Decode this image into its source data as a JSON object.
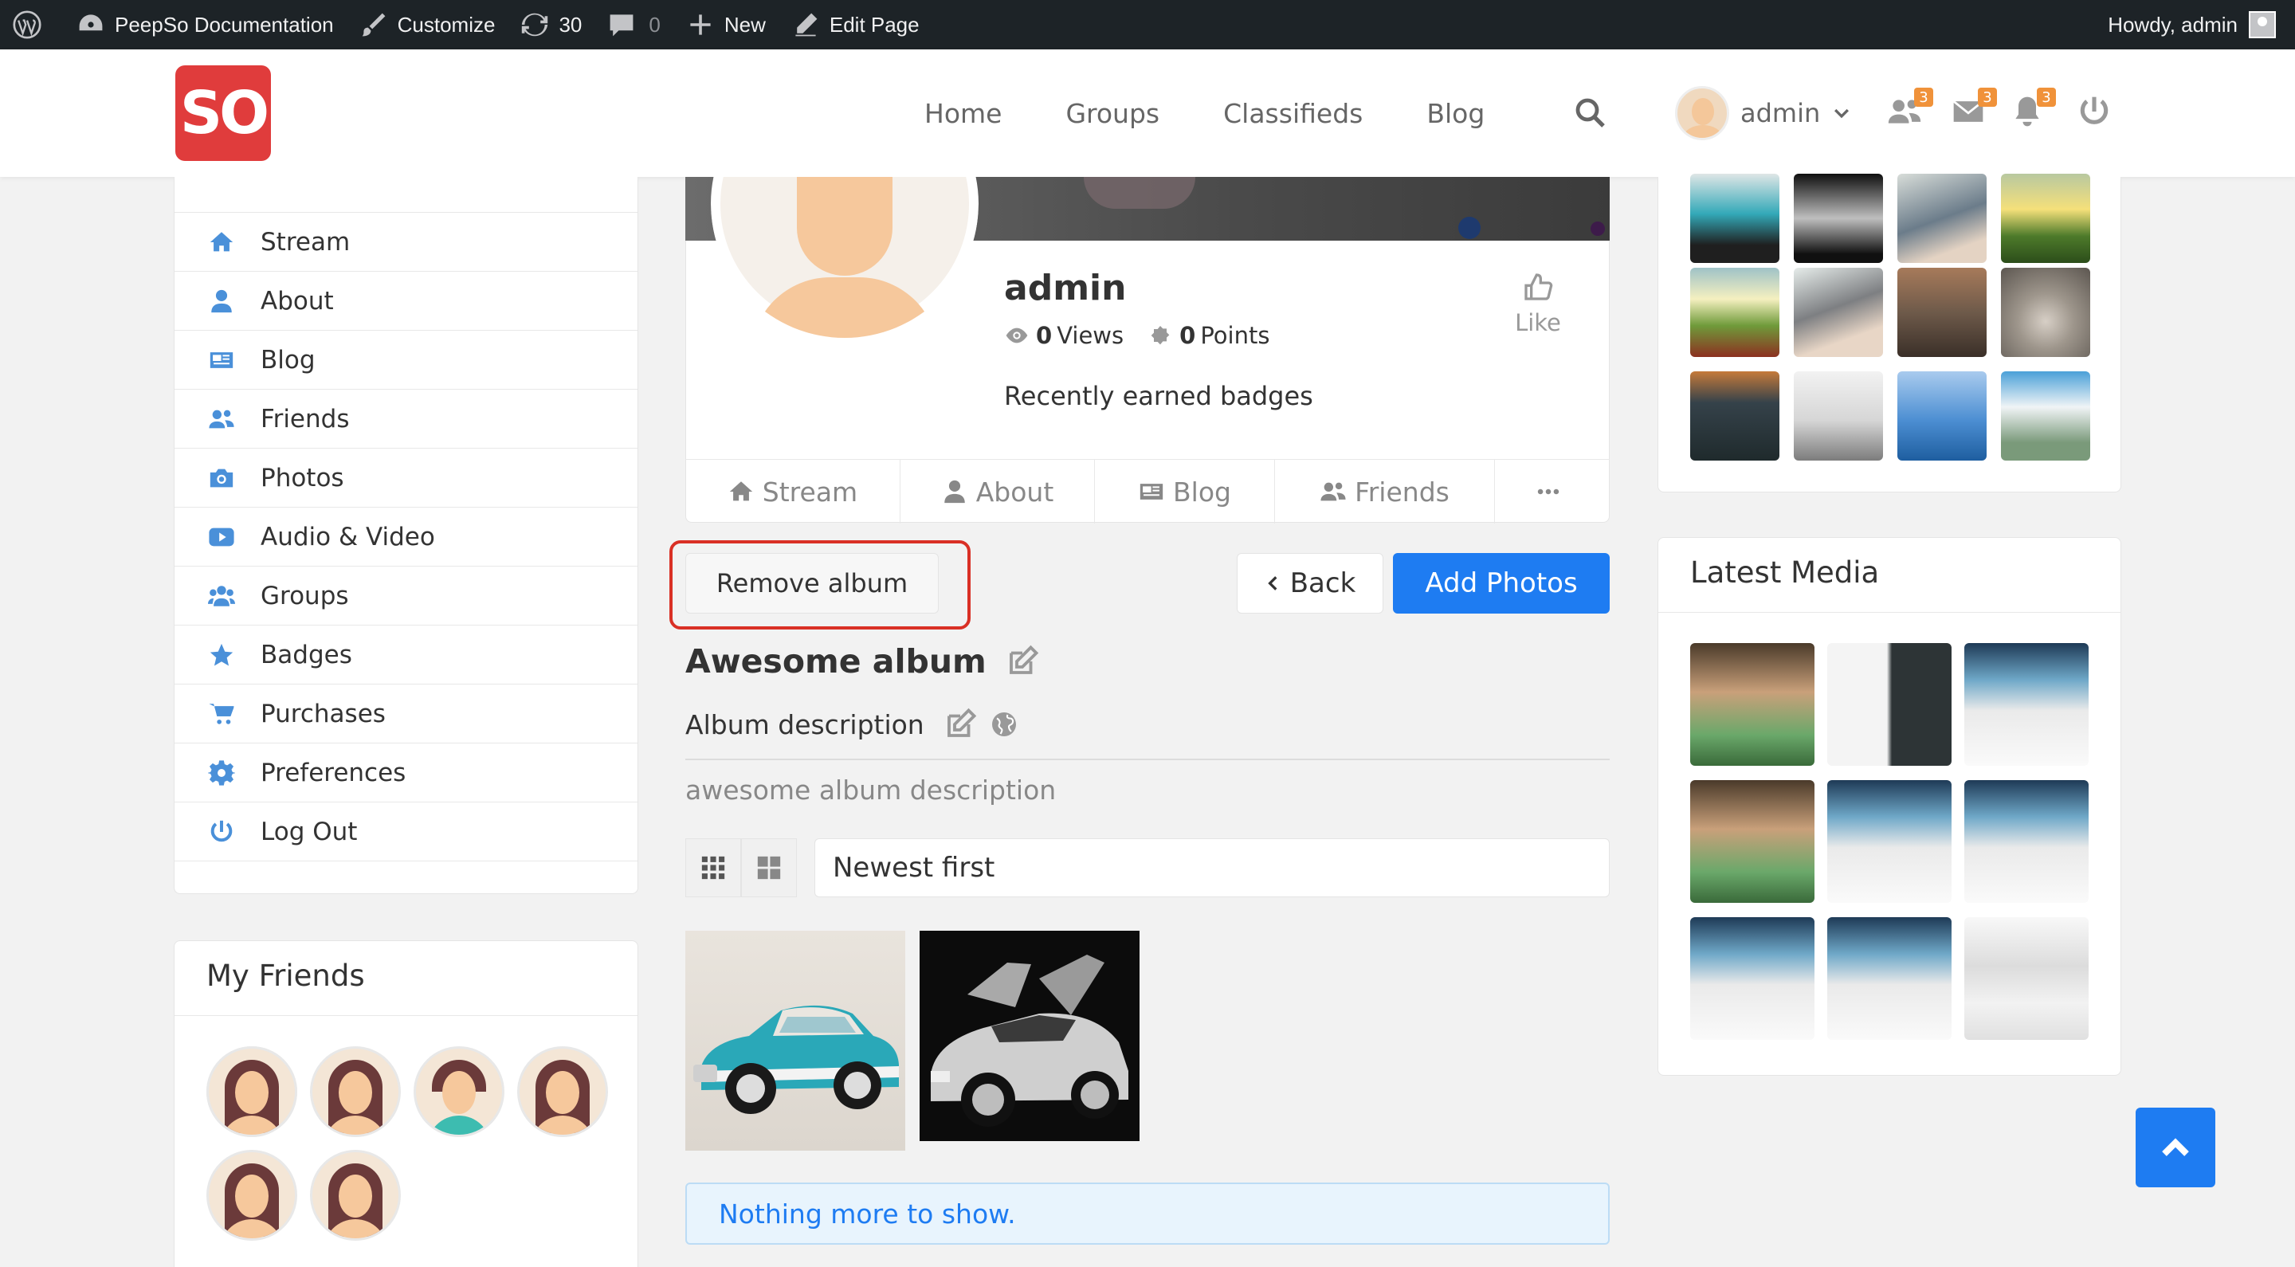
{
  "adminbar": {
    "site_name": "PeepSo Documentation",
    "customize": "Customize",
    "updates_count": "30",
    "comments_count": "0",
    "new_label": "New",
    "edit_page": "Edit Page",
    "howdy": "Howdy, admin"
  },
  "header": {
    "logo_text": "SO",
    "nav": [
      "Home",
      "Groups",
      "Classifieds",
      "Blog"
    ],
    "user_name": "admin",
    "friends_badge": "3",
    "messages_badge": "3",
    "notifications_badge": "3"
  },
  "sidebar": {
    "items": [
      "Stream",
      "About",
      "Blog",
      "Friends",
      "Photos",
      "Audio & Video",
      "Groups",
      "Badges",
      "Purchases",
      "Preferences",
      "Log Out"
    ]
  },
  "friends_box": {
    "title": "My Friends"
  },
  "profile": {
    "name": "admin",
    "views_count": "0",
    "views_label": "Views",
    "points_count": "0",
    "points_label": "Points",
    "like_label": "Like",
    "badges_text": "Recently earned badges",
    "tabs": [
      "Stream",
      "About",
      "Blog",
      "Friends"
    ]
  },
  "album": {
    "remove_label": "Remove album",
    "back_label": "Back",
    "add_photos_label": "Add Photos",
    "title": "Awesome album",
    "description_label": "Album description",
    "description_text": "awesome album description",
    "sort_value": "Newest first",
    "nothing_more": "Nothing more to show."
  },
  "latest_media": {
    "title": "Latest Media"
  },
  "colors": {
    "accent": "#1e7cf2",
    "logo": "#e03c3c",
    "badge": "#f0923a",
    "highlight": "#d93025",
    "sidebar_icon": "#4a90d9"
  }
}
